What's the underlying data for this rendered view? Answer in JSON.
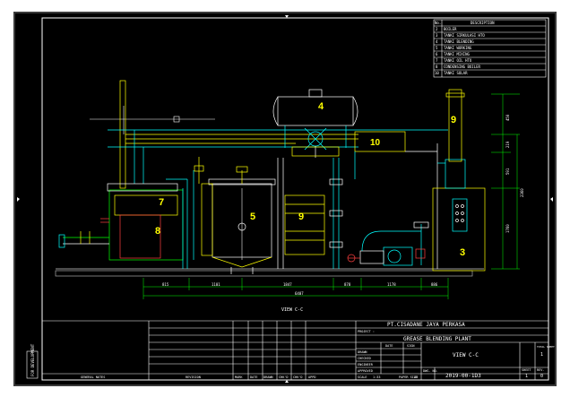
{
  "drawing": {
    "view_label": "VIEW C-C",
    "company": "PT.CISADANE JAYA PERKASA",
    "project": "GREASE BLENDING PLANT",
    "project_tag": "PROJECT :",
    "sheet_view": "VIEW C-C",
    "drawing_no": "2019-00-1D3",
    "sheet_no": "1",
    "rev_no": "0",
    "total_sheet": "1",
    "scale": "1:33",
    "paper_size": "A3",
    "side_stamp": "FOR DEVELOPMENT",
    "sign_rows": [
      "DRAWN",
      "CHECKED",
      "ENGINEER",
      "APPROVED"
    ],
    "sign_head": [
      "DATE",
      "SIGN"
    ],
    "labels": {
      "scale": "SCALE",
      "paper": "PAPER SIZE",
      "dwg": "DWG. NO.",
      "sheet": "SHEET",
      "rev": "REV.",
      "total": "TOTAL SHEET"
    },
    "footer_left": "GENERAL NOTES",
    "footer_mid": "REVISION",
    "footer_cols": [
      "MARK",
      "DATE",
      "DRAWN",
      "CHK'D",
      "CHK'D",
      "APPD"
    ]
  },
  "legend": {
    "header_no": "No.",
    "header_desc": "DESCRIPTION",
    "rows": [
      {
        "no": "2",
        "desc": "BOILER"
      },
      {
        "no": "3",
        "desc": "TANKI SIRKULASI HTO"
      },
      {
        "no": "4",
        "desc": "TANKI BLENDING"
      },
      {
        "no": "5",
        "desc": "TANKI WORKING"
      },
      {
        "no": "6",
        "desc": "TANKI MIXING"
      },
      {
        "no": "7",
        "desc": "TANKI OIL HTO"
      },
      {
        "no": "8",
        "desc": "CONDENSING BOILER"
      },
      {
        "no": "10",
        "desc": "TANKI SOLAR"
      }
    ]
  },
  "equipment_tags": [
    "3",
    "4",
    "5",
    "6",
    "7",
    "8",
    "9",
    "10"
  ],
  "dimensions": {
    "horizontal": [
      "815",
      "1101",
      "1847",
      "878",
      "1178",
      "886"
    ],
    "overall": "6407",
    "vertical": [
      "450",
      "219",
      "591",
      "2360",
      "1760"
    ]
  }
}
